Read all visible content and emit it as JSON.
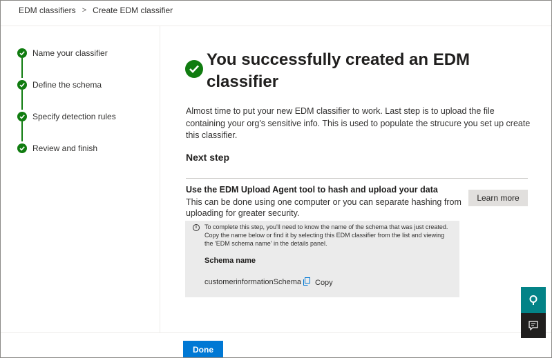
{
  "breadcrumb": {
    "items": [
      "EDM classifiers",
      "Create EDM classifier"
    ],
    "separator": ">"
  },
  "steps": [
    {
      "label": "Name your classifier",
      "status": "complete"
    },
    {
      "label": "Define the schema",
      "status": "complete"
    },
    {
      "label": "Specify detection rules",
      "status": "complete"
    },
    {
      "label": "Review and finish",
      "status": "complete"
    }
  ],
  "main": {
    "title": "You successfully created an EDM classifier",
    "intro": "Almost time to put your new EDM classifier to work. Last step is to upload the file containing your org's sensitive info. This is used to populate the strucure you set up create this classifier.",
    "next_step_heading": "Next step",
    "agent_title": "Use the EDM Upload Agent tool to hash and upload your data",
    "agent_desc": "This can be done using one computer or you can separate hashing from uploading for greater security.",
    "learn_more_label": "Learn more",
    "info": {
      "icon_glyph": "i",
      "text": "To complete this step, you'll need to know the name of the schema that was just created. Copy the name below or find it by selecting this EDM classifier from the list and viewing the 'EDM schema name' in the details panel.",
      "schema_label": "Schema name",
      "schema_value": "customerinformationSchema",
      "copy_label": "Copy"
    }
  },
  "footer": {
    "done_label": "Done"
  },
  "icons": {
    "step": "checkmark-icon",
    "hero": "checkmark-circle-icon",
    "copy": "copy-icon",
    "help": "help-chat-icon",
    "feedback": "feedback-icon"
  },
  "colors": {
    "success": "#107c10",
    "primary": "#0078d4",
    "teal": "#038387",
    "dark": "#201f1e",
    "info_bg": "#ebebeb"
  }
}
